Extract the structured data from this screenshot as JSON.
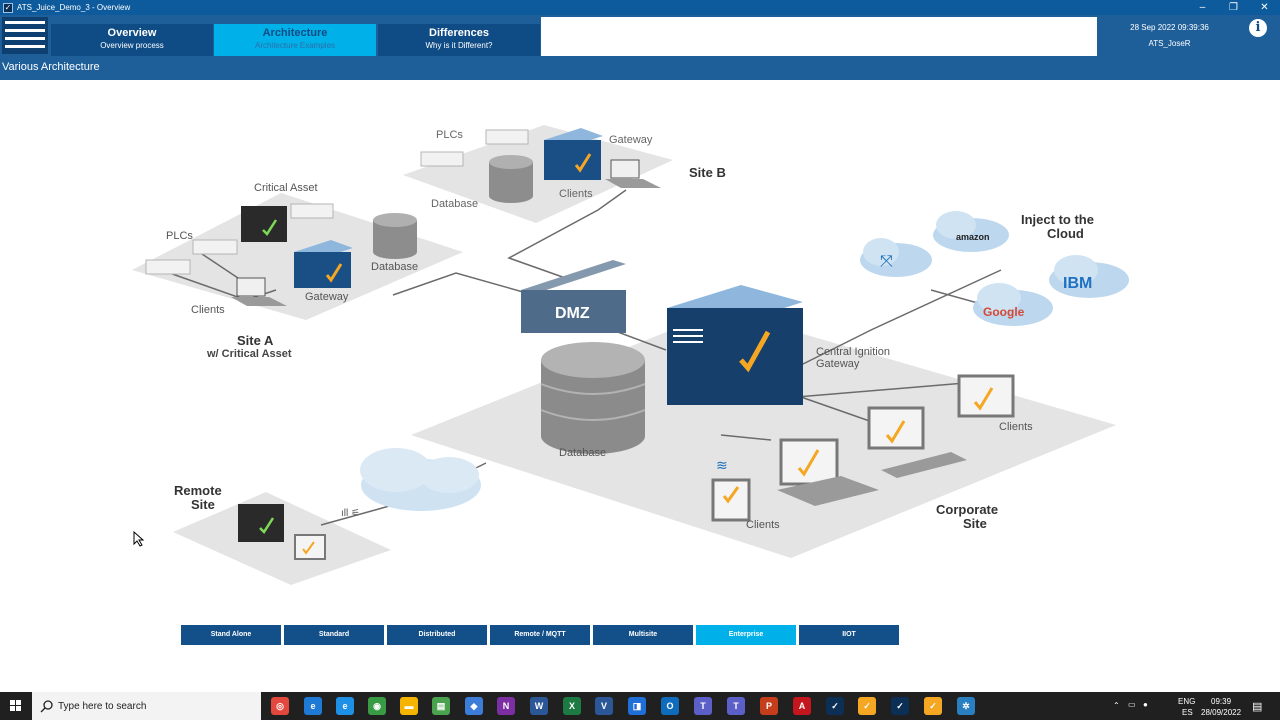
{
  "window": {
    "title": "ATS_Juice_Demo_3 - Overview",
    "minimize": "–",
    "restore": "❐",
    "close": "✕"
  },
  "header": {
    "tabs": [
      {
        "title": "Overview",
        "subtitle": "Overview process"
      },
      {
        "title": "Architecture",
        "subtitle": "Architecture Examples"
      },
      {
        "title": "Differences",
        "subtitle": "Why is it Different?"
      }
    ],
    "datetime": "28 Sep 2022 09:39:36",
    "user": "ATS_JoseR",
    "info": "i"
  },
  "page": {
    "title": "Various Architecture"
  },
  "diagram": {
    "site_b": {
      "plcs": "PLCs",
      "gateway": "Gateway",
      "clients": "Clients",
      "database": "Database",
      "title": "Site B"
    },
    "site_a": {
      "critical_asset": "Critical Asset",
      "plcs": "PLCs",
      "database": "Database",
      "gateway": "Gateway",
      "clients": "Clients",
      "title": "Site A",
      "subtitle": "w/ Critical Asset"
    },
    "dmz": "DMZ",
    "cloud": {
      "title_line1": "Inject to the",
      "title_line2": "Cloud",
      "amazon": "amazon",
      "amazon_sub": "web services",
      "ibm": "IBM",
      "google": "Google"
    },
    "central": {
      "line1": "Central Ignition",
      "line2": "Gateway",
      "database": "Database",
      "clients_right": "Clients",
      "clients_bottom": "Clients",
      "site_line1": "Corporate",
      "site_line2": "Site"
    },
    "remote": {
      "line1": "Remote",
      "line2": "Site"
    }
  },
  "arch_buttons": [
    "Stand Alone",
    "Standard",
    "Distributed",
    "Remote / MQTT",
    "Multisite",
    "Enterprise",
    "IIOT"
  ],
  "taskbar": {
    "search_placeholder": "Type here to search",
    "lang1": "ENG",
    "lang2": "ES",
    "time": "09:39",
    "date": "28/09/2022"
  },
  "colors": {
    "header": "#1e5f9a",
    "tab_dark": "#0f4b85",
    "tab_active": "#00b0e8",
    "button": "#134f89"
  }
}
